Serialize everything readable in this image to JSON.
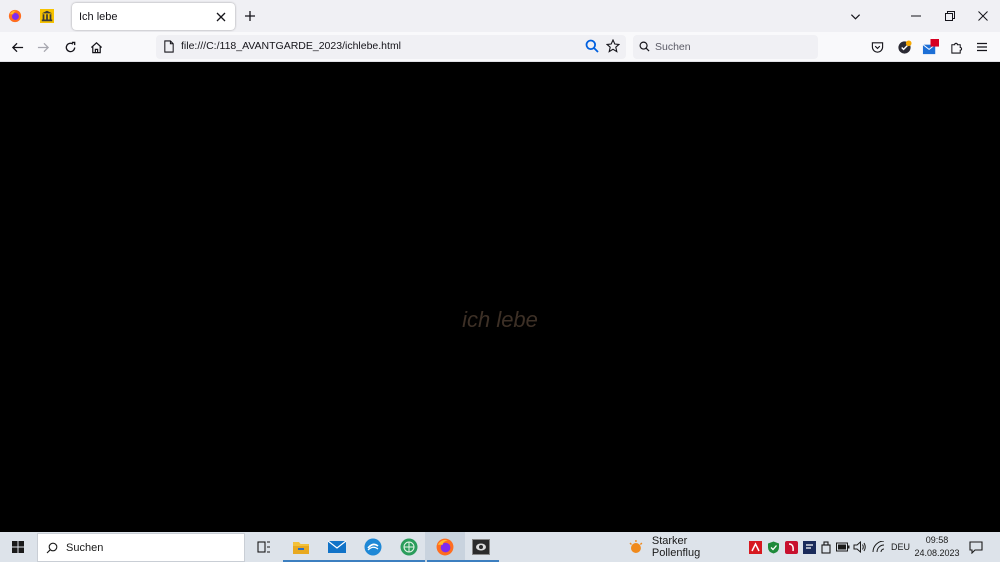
{
  "browser": {
    "active_tab": {
      "title": "Ich lebe"
    },
    "url": "file:///C:/118_AVANTGARDE_2023/ichlebe.html",
    "search_placeholder": "Suchen",
    "account_badge": "X"
  },
  "page": {
    "text": "ich lebe",
    "text_color": "#3d3026",
    "background": "#000000"
  },
  "taskbar": {
    "search_label": "Suchen",
    "weather_text": "Starker Pollenflug",
    "language": "DEU",
    "time": "09:58",
    "date": "24.08.2023",
    "pinned_apps": [
      "task-view",
      "file-explorer",
      "mail",
      "onedrive-sync",
      "globe-app",
      "firefox",
      "media-app"
    ]
  },
  "colors": {
    "accent": "#0060df",
    "taskbar": "#dde3ea"
  }
}
